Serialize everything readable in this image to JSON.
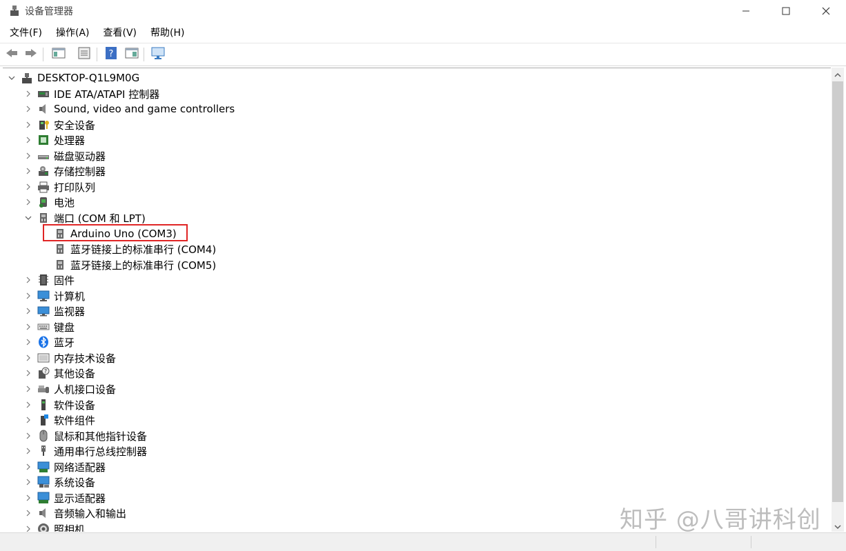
{
  "window": {
    "title": "设备管理器",
    "controls": {
      "minimize_icon": "minimize-icon",
      "maximize_icon": "maximize-icon",
      "close_icon": "close-icon"
    }
  },
  "menu": [
    {
      "label": "文件(F)"
    },
    {
      "label": "操作(A)"
    },
    {
      "label": "查看(V)"
    },
    {
      "label": "帮助(H)"
    }
  ],
  "toolbar": {
    "buttons": [
      "back-icon",
      "forward-icon",
      "show-hide-tree-icon",
      "properties-icon",
      "help-icon",
      "action-pane-icon",
      "monitor-icon"
    ]
  },
  "tree": {
    "root": {
      "label": "DESKTOP-Q1L9M0G",
      "icon": "computer-icon",
      "expanded": true
    },
    "categories": [
      {
        "label": "IDE ATA/ATAPI 控制器",
        "icon": "ide-controller-icon"
      },
      {
        "label": "Sound, video and game controllers",
        "icon": "speaker-icon"
      },
      {
        "label": "安全设备",
        "icon": "security-device-icon"
      },
      {
        "label": "处理器",
        "icon": "processor-icon"
      },
      {
        "label": "磁盘驱动器",
        "icon": "disk-drive-icon"
      },
      {
        "label": "存储控制器",
        "icon": "storage-controller-icon"
      },
      {
        "label": "打印队列",
        "icon": "printer-icon"
      },
      {
        "label": "电池",
        "icon": "battery-icon"
      },
      {
        "label": "端口 (COM 和 LPT)",
        "icon": "port-icon",
        "expanded": true,
        "children": [
          {
            "label": "Arduino Uno (COM3)",
            "icon": "port-icon",
            "highlighted": true
          },
          {
            "label": "蓝牙链接上的标准串行 (COM4)",
            "icon": "port-icon"
          },
          {
            "label": "蓝牙链接上的标准串行 (COM5)",
            "icon": "port-icon"
          }
        ]
      },
      {
        "label": "固件",
        "icon": "firmware-icon"
      },
      {
        "label": "计算机",
        "icon": "computer-monitor-icon"
      },
      {
        "label": "监视器",
        "icon": "monitor-icon"
      },
      {
        "label": "键盘",
        "icon": "keyboard-icon"
      },
      {
        "label": "蓝牙",
        "icon": "bluetooth-icon"
      },
      {
        "label": "内存技术设备",
        "icon": "memory-device-icon"
      },
      {
        "label": "其他设备",
        "icon": "other-device-icon"
      },
      {
        "label": "人机接口设备",
        "icon": "hid-icon"
      },
      {
        "label": "软件设备",
        "icon": "software-device-icon"
      },
      {
        "label": "软件组件",
        "icon": "software-component-icon"
      },
      {
        "label": "鼠标和其他指针设备",
        "icon": "mouse-icon"
      },
      {
        "label": "通用串行总线控制器",
        "icon": "usb-icon"
      },
      {
        "label": "网络适配器",
        "icon": "network-adapter-icon"
      },
      {
        "label": "系统设备",
        "icon": "system-device-icon"
      },
      {
        "label": "显示适配器",
        "icon": "display-adapter-icon"
      },
      {
        "label": "音频输入和输出",
        "icon": "audio-io-icon"
      },
      {
        "label": "照相机",
        "icon": "camera-icon"
      }
    ]
  },
  "watermark": "知乎 @八哥讲科创",
  "colors": {
    "highlight": "#e02424",
    "bluetooth": "#1a73e8",
    "monitor": "#3b8fd8"
  }
}
